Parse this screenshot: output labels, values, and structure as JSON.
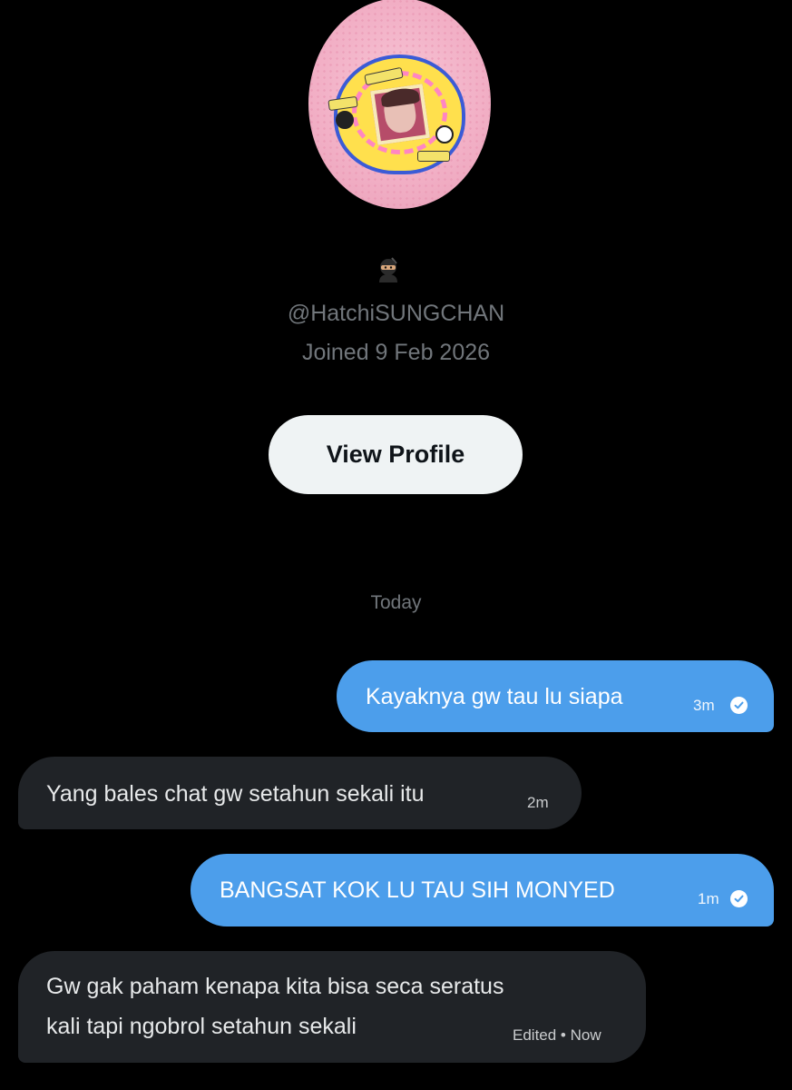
{
  "profile": {
    "emoji": "ninja",
    "handle": "@HatchiSUNGCHAN",
    "joined": "Joined 9 Feb 2026",
    "view_profile_label": "View Profile"
  },
  "conversation": {
    "day_separator": "Today",
    "messages": [
      {
        "direction": "outgoing",
        "text": "Kayaknya gw tau lu siapa",
        "time": "3m",
        "status_icon": "read-check-icon"
      },
      {
        "direction": "incoming",
        "text": "Yang bales chat gw setahun sekali itu",
        "time": "2m"
      },
      {
        "direction": "outgoing",
        "text": "BANGSAT KOK LU TAU SIH MONYED",
        "time": "1m",
        "status_icon": "read-check-icon"
      },
      {
        "direction": "incoming",
        "text_line1": "Gw gak paham kenapa kita bisa seca seratus",
        "text_line2": "kali tapi ngobrol setahun sekali",
        "time": "Edited • Now"
      }
    ]
  },
  "colors": {
    "background": "#000000",
    "outgoing_bubble": "#4c9eeb",
    "incoming_bubble": "#202327",
    "secondary_text": "#71767b",
    "button_bg": "#eff3f4"
  }
}
